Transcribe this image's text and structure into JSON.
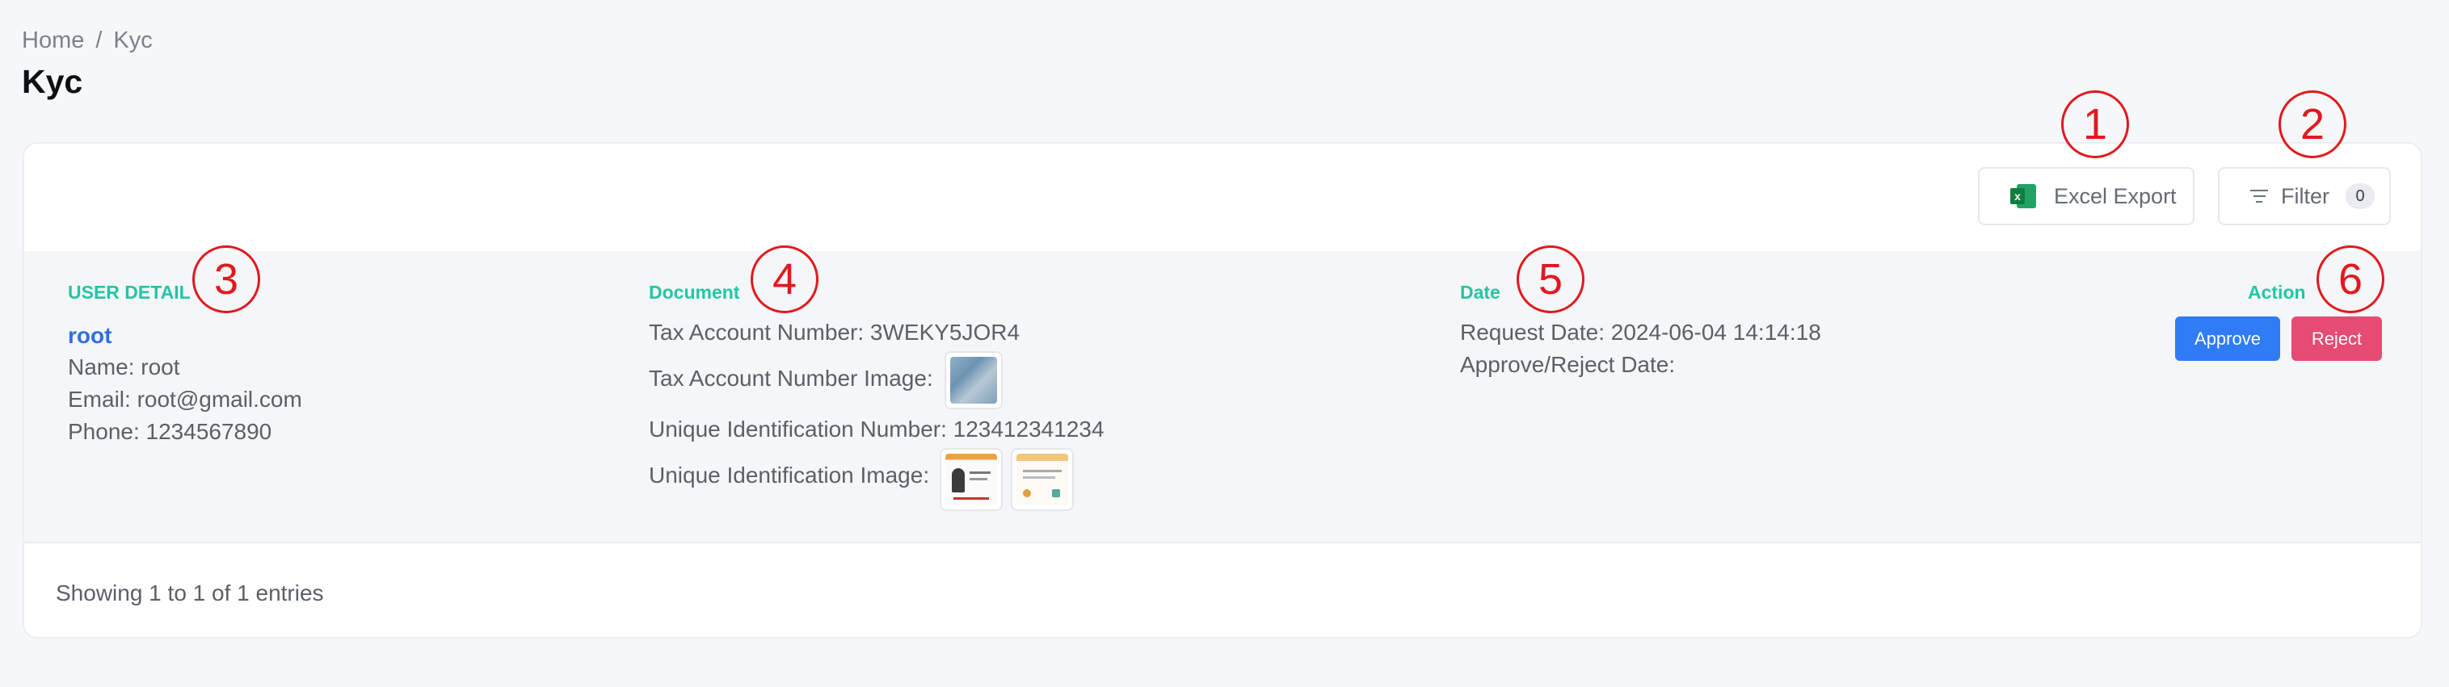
{
  "breadcrumb": {
    "home": "Home",
    "separator": "/",
    "current": "Kyc"
  },
  "page_title": "Kyc",
  "toolbar": {
    "excel_export_label": "Excel Export",
    "filter_label": "Filter",
    "filter_count": "0"
  },
  "table": {
    "headers": {
      "user_detail": "USER DETAIL",
      "document": "Document",
      "date": "Date",
      "action": "Action"
    },
    "rows": [
      {
        "username": "root",
        "name": "Name: root",
        "email": "Email: root@gmail.com",
        "phone": "Phone: 1234567890",
        "tax_account_number": "Tax Account Number: 3WEKY5JOR4",
        "tax_account_number_image_label": "Tax Account Number Image:",
        "unique_identification_number": "Unique Identification Number: 123412341234",
        "unique_identification_image_label": "Unique Identification Image:",
        "request_date": "Request Date: 2024-06-04 14:14:18",
        "approve_reject_date": "Approve/Reject Date:",
        "approve_label": "Approve",
        "reject_label": "Reject"
      }
    ]
  },
  "footer": {
    "entries_text": "Showing 1 to 1 of 1 entries"
  },
  "callouts": [
    "1",
    "2",
    "3",
    "4",
    "5",
    "6"
  ],
  "colors": {
    "accent_heading": "#24c5a3",
    "link": "#2f6fe0",
    "approve": "#2f7cf6",
    "reject": "#e54b73",
    "callout": "#e0191f"
  },
  "icons": [
    "excel-icon",
    "filter-icon"
  ]
}
